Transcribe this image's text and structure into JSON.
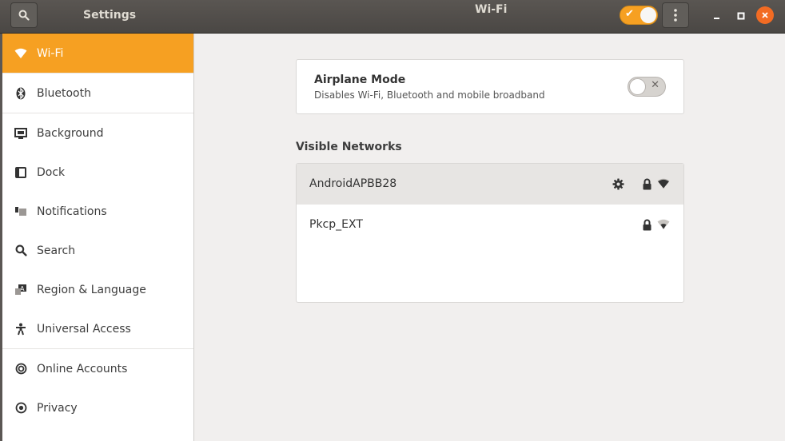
{
  "header": {
    "app_title": "Settings",
    "panel_title": "Wi-Fi",
    "wifi_enabled": true
  },
  "sidebar": {
    "items": [
      {
        "label": "Wi-Fi",
        "icon": "wifi-icon",
        "active": true
      },
      {
        "label": "Bluetooth",
        "icon": "bluetooth-icon"
      },
      {
        "label": "Background",
        "icon": "background-icon"
      },
      {
        "label": "Dock",
        "icon": "dock-icon"
      },
      {
        "label": "Notifications",
        "icon": "notifications-icon"
      },
      {
        "label": "Search",
        "icon": "search-icon"
      },
      {
        "label": "Region & Language",
        "icon": "region-icon"
      },
      {
        "label": "Universal Access",
        "icon": "universal-access-icon"
      },
      {
        "label": "Online Accounts",
        "icon": "online-accounts-icon"
      },
      {
        "label": "Privacy",
        "icon": "privacy-icon"
      }
    ]
  },
  "airplane": {
    "title": "Airplane Mode",
    "subtitle": "Disables Wi-Fi, Bluetooth and mobile broadband",
    "enabled": false
  },
  "networks": {
    "heading": "Visible Networks",
    "items": [
      {
        "name": "AndroidAPBB28",
        "connected": true,
        "secured": true
      },
      {
        "name": "Pkcp_EXT",
        "connected": false,
        "secured": true
      }
    ]
  },
  "colors": {
    "accent": "#f6a022",
    "close": "#f26b23",
    "headerbar": "#4f4c49"
  }
}
